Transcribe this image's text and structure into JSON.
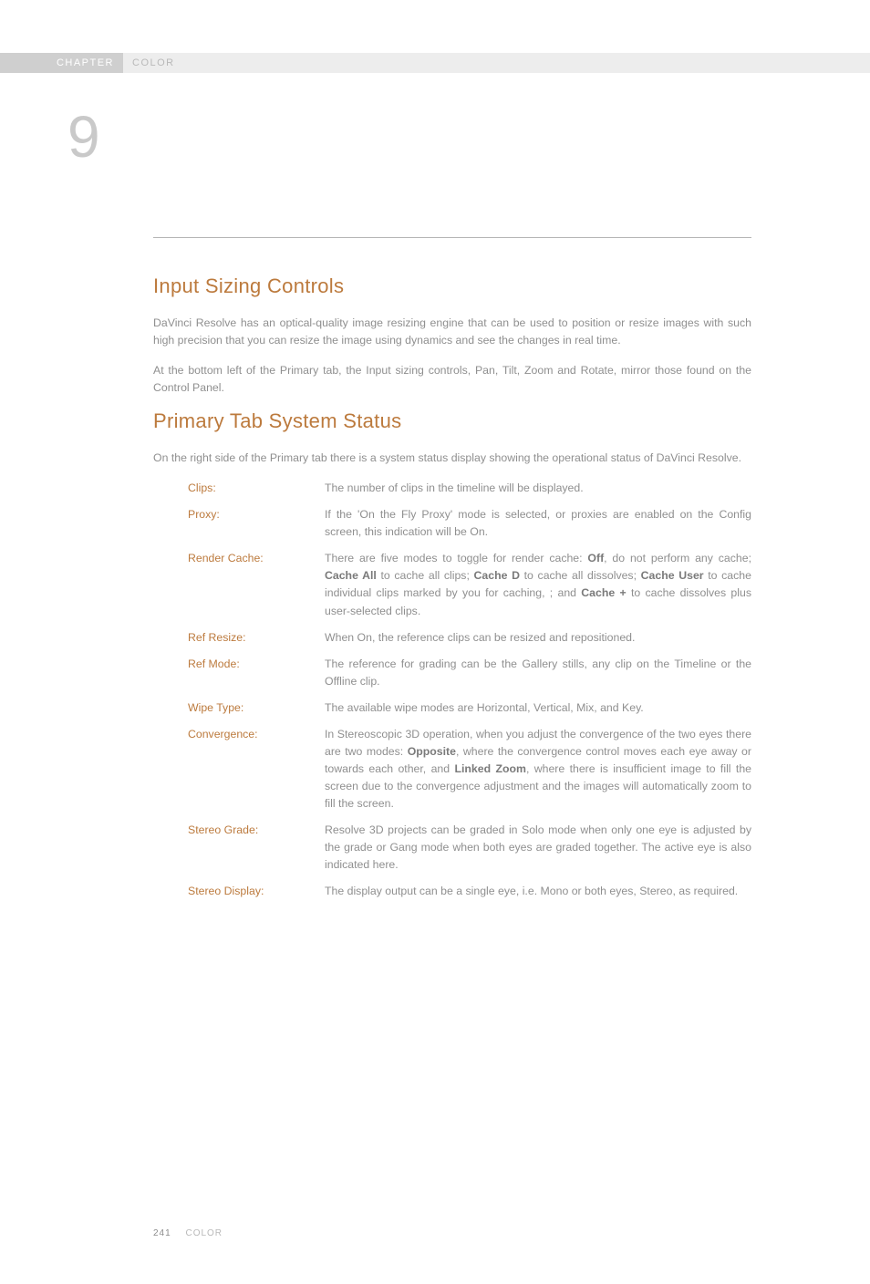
{
  "header": {
    "label": "CHAPTER",
    "title": "COLOR",
    "number": "9"
  },
  "sections": {
    "input_sizing": {
      "heading": "Input Sizing Controls",
      "p1": "DaVinci Resolve has an optical-quality image resizing engine that can be used to position or resize images with such high precision that you can resize the image using dynamics and see the changes in real time.",
      "p2": "At the bottom left of the Primary tab, the Input sizing controls, Pan, Tilt, Zoom and Rotate, mirror those found on the Control Panel."
    },
    "primary_tab": {
      "heading": "Primary Tab System Status",
      "intro": "On the right side of the Primary tab there is a system status display showing the operational status of DaVinci Resolve.",
      "items": [
        {
          "term": "Clips:",
          "desc": "The number of clips in the timeline will be displayed."
        },
        {
          "term": "Proxy:",
          "desc": "If the 'On the Fly Proxy' mode is selected, or proxies are enabled on the Config screen, this indication will be On."
        },
        {
          "term": "Render Cache:",
          "desc": "There are five modes to toggle for render cache: <b>Off</b>, do not perform any cache; <b>Cache All</b> to cache all clips; <b>Cache D</b> to cache all dissolves; <b>Cache User</b> to cache individual clips marked by you for caching, ; and <b>Cache +</b> to cache dissolves plus user-selected clips."
        },
        {
          "term": "Ref Resize:",
          "desc": "When On, the reference clips can be resized and repositioned."
        },
        {
          "term": "Ref Mode:",
          "desc": "The reference for grading can be the Gallery stills, any clip on the Timeline or the Offline clip."
        },
        {
          "term": "Wipe Type:",
          "desc": "The available wipe modes are Horizontal, Vertical, Mix, and Key."
        },
        {
          "term": "Convergence:",
          "desc": "In Stereoscopic 3D operation, when you adjust the convergence of the two eyes there are two modes: <b>Opposite</b>, where the convergence control moves each eye away or towards each other, and <b>Linked Zoom</b>, where there is insufficient image to fill the screen due to the convergence adjustment and the images will automatically zoom to fill the screen."
        },
        {
          "term": "Stereo Grade:",
          "desc": "Resolve 3D projects can be graded in Solo mode when only one eye is adjusted by the grade or Gang mode when both eyes are graded together. The active eye is also indicated here."
        },
        {
          "term": "Stereo Display:",
          "desc": "The display output can be a single eye, i.e. Mono or both eyes, Stereo, as required."
        }
      ]
    }
  },
  "footer": {
    "page": "241",
    "section": "COLOR"
  }
}
